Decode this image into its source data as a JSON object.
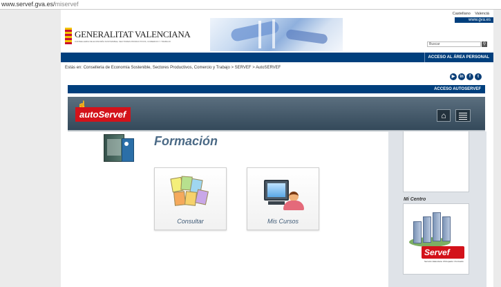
{
  "browser": {
    "url_domain": "www.servef.gva.es/",
    "url_path": "miservef"
  },
  "header": {
    "logo_title": "GENERALITAT VALENCIANA",
    "logo_sub": "CONSELLERIA DE ECONOMÍA SOSTENIBLE, SECTORES PRODUCTIVOS, COMERCIO Y TRABAJO",
    "lang_es": "Castellano",
    "lang_va": "Valencià",
    "gva_link": "www.gva.es",
    "search_placeholder": "Buscar",
    "area_personal": "ACCESO AL ÁREA PERSONAL"
  },
  "breadcrumb": {
    "prefix": "Estás en:",
    "items": [
      "Conselleria de Economía Sostenible, Sectores Productivos, Comercio y Trabajo",
      "SERVEF",
      "AutoSERVEF"
    ],
    "sep": ">"
  },
  "social": {
    "youtube": "▶",
    "linkedin": "in",
    "facebook": "f",
    "twitter": "t"
  },
  "autoservef": {
    "bar_label": "ACCESO AUTOSERVEF",
    "logo_text": "autoServef",
    "home_icon": "⌂"
  },
  "main": {
    "title": "Formación",
    "cards": [
      {
        "label": "Consultar"
      },
      {
        "label": "Mis Cursos"
      }
    ]
  },
  "sidebar": {
    "mi_centro": "Mi Centro",
    "servef_logo": "Servef",
    "servef_sub": "Servicio Valenciano d'Ocupació i Formació"
  }
}
